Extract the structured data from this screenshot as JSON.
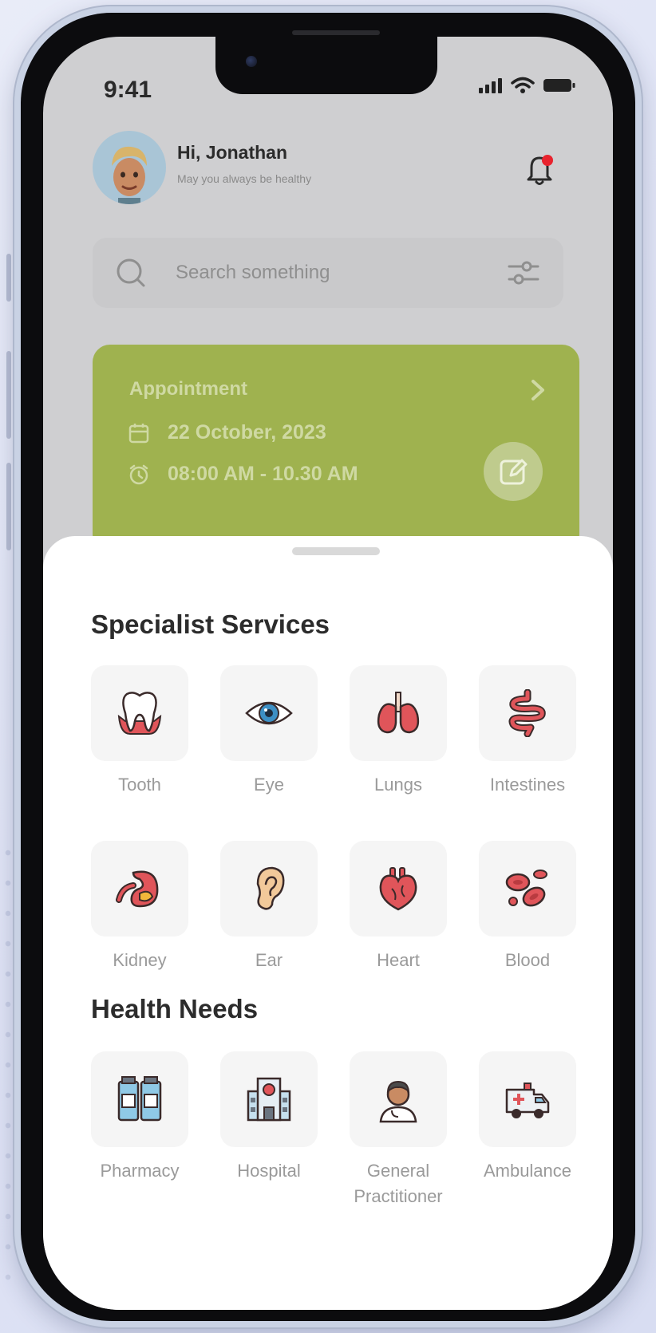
{
  "status_bar": {
    "time": "9:41"
  },
  "header": {
    "greeting": "Hi, Jonathan",
    "subtitle": "May you always be healthy"
  },
  "search": {
    "placeholder": "Search something"
  },
  "appointment": {
    "title": "Appointment",
    "date": "22 October, 2023",
    "time": "08:00 AM - 10.30 AM"
  },
  "specialist": {
    "title": "Specialist  Services",
    "items": [
      {
        "label": "Tooth",
        "icon": "tooth-icon"
      },
      {
        "label": "Eye",
        "icon": "eye-icon"
      },
      {
        "label": "Lungs",
        "icon": "lungs-icon"
      },
      {
        "label": "Intestines",
        "icon": "intestines-icon"
      },
      {
        "label": "Kidney",
        "icon": "kidney-icon"
      },
      {
        "label": "Ear",
        "icon": "ear-icon"
      },
      {
        "label": "Heart",
        "icon": "heart-icon"
      },
      {
        "label": "Blood",
        "icon": "blood-icon"
      }
    ]
  },
  "health_needs": {
    "title": "Health Needs",
    "items": [
      {
        "label": "Pharmacy",
        "icon": "pharmacy-icon"
      },
      {
        "label": "Hospital",
        "icon": "hospital-icon"
      },
      {
        "label": "General Practitioner",
        "icon": "doctor-icon"
      },
      {
        "label": "Ambulance",
        "icon": "ambulance-icon"
      }
    ]
  },
  "colors": {
    "accent": "#9fb24f",
    "icon_red": "#e0555a",
    "notification": "#e8232e"
  }
}
